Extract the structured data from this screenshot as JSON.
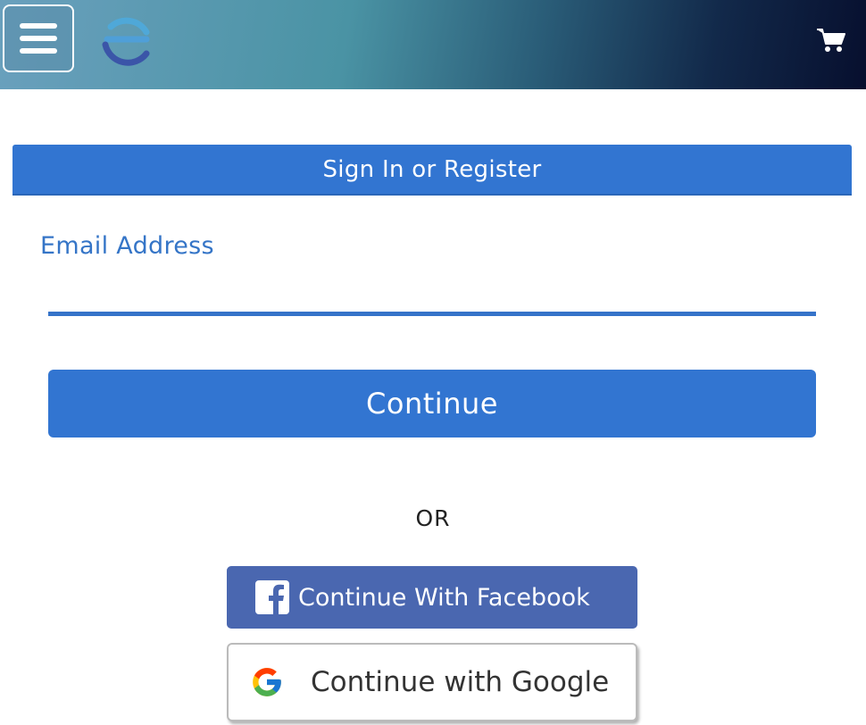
{
  "header": {
    "menu_icon": "hamburger-menu-icon",
    "logo_icon": "brand-logo-icon",
    "cart_icon": "shopping-cart-icon"
  },
  "signin": {
    "title": "Sign In or Register"
  },
  "form": {
    "email_label": "Email Address",
    "email_value": "",
    "continue_label": "Continue"
  },
  "divider": {
    "or_text": "OR"
  },
  "social": {
    "facebook_label": "Continue With Facebook",
    "facebook_icon": "facebook-icon",
    "google_label": "Continue with Google",
    "google_icon": "google-icon"
  },
  "colors": {
    "primary": "#3275d1",
    "facebook": "#4a67b0",
    "label": "#3575c7"
  }
}
